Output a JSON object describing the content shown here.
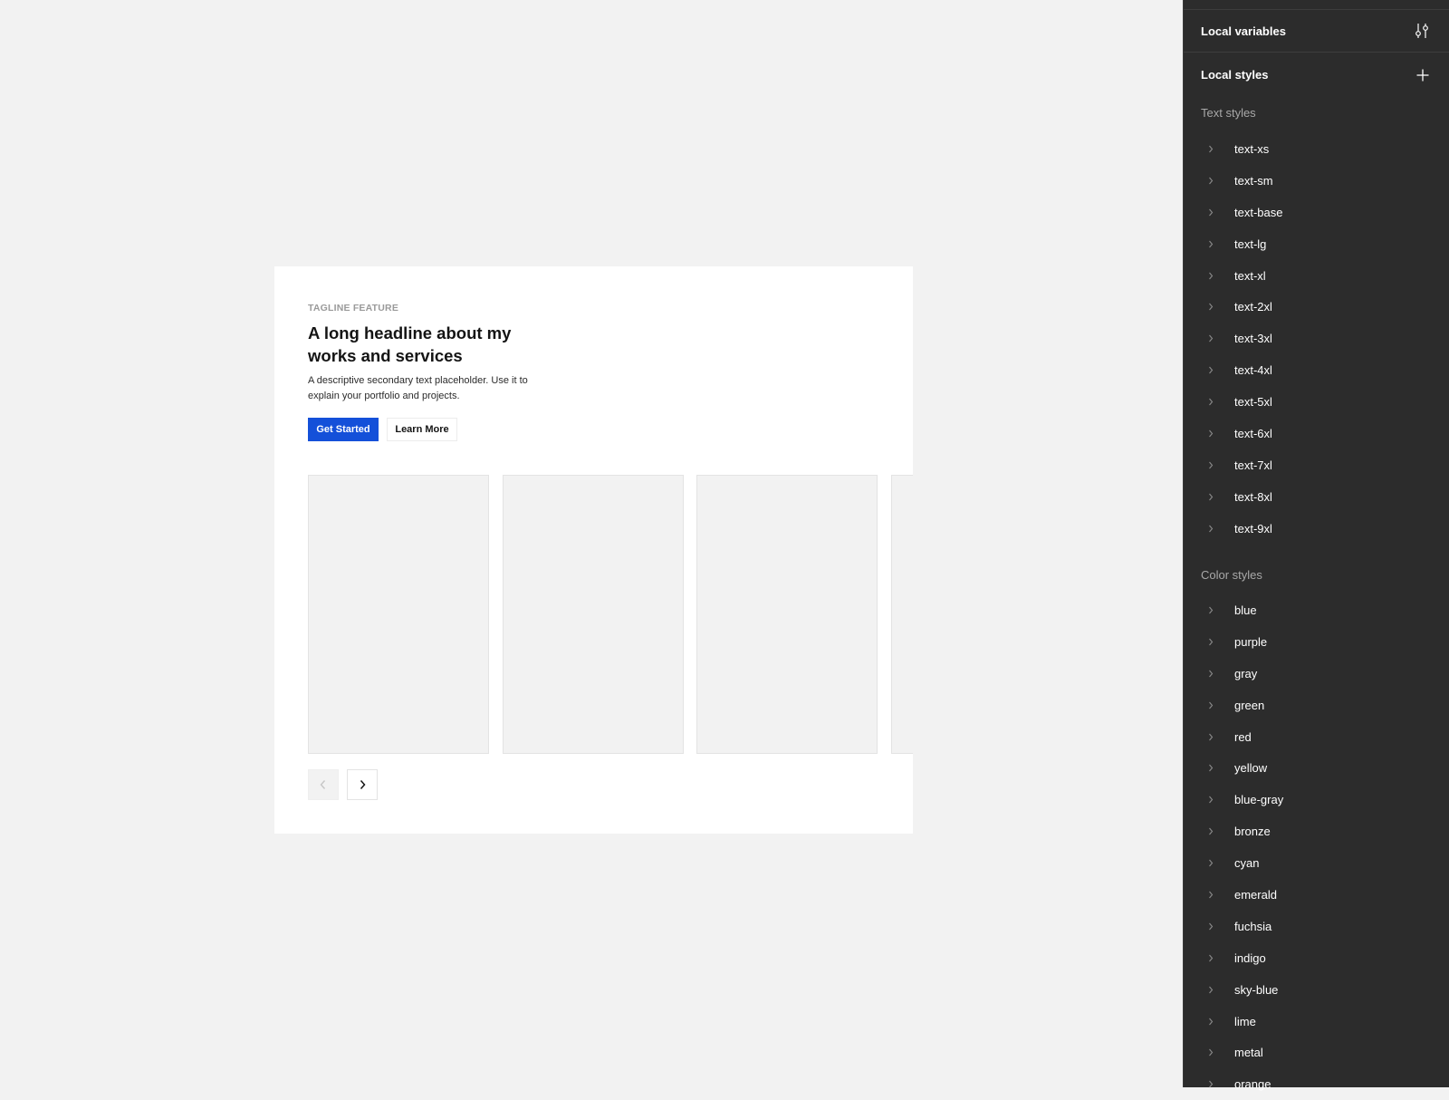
{
  "hero": {
    "tagline": "TAGLINE FEATURE",
    "headline": "A long headline about my works and services",
    "description": "A descriptive secondary text placeholder. Use it to explain your portfolio and projects.",
    "primary_button": "Get Started",
    "secondary_button": "Learn More"
  },
  "carousel": {
    "prev_icon": "chevron-left-icon",
    "next_icon": "chevron-right-icon",
    "prev_disabled": true
  },
  "panel": {
    "local_variables": "Local variables",
    "local_variables_icon": "adjust-sliders-icon",
    "local_styles": "Local styles",
    "add_icon": "plus-icon",
    "text_styles_label": "Text styles",
    "text_styles": [
      "text-xs",
      "text-sm",
      "text-base",
      "text-lg",
      "text-xl",
      "text-2xl",
      "text-3xl",
      "text-4xl",
      "text-5xl",
      "text-6xl",
      "text-7xl",
      "text-8xl",
      "text-9xl"
    ],
    "color_styles_label": "Color styles",
    "color_styles": [
      "blue",
      "purple",
      "gray",
      "green",
      "red",
      "yellow",
      "blue-gray",
      "bronze",
      "cyan",
      "emerald",
      "fuchsia",
      "indigo",
      "sky-blue",
      "lime",
      "metal",
      "orange"
    ]
  },
  "colors": {
    "primary": "#1450d9",
    "canvas": "#f2f2f2",
    "panel": "#2c2c2c"
  }
}
